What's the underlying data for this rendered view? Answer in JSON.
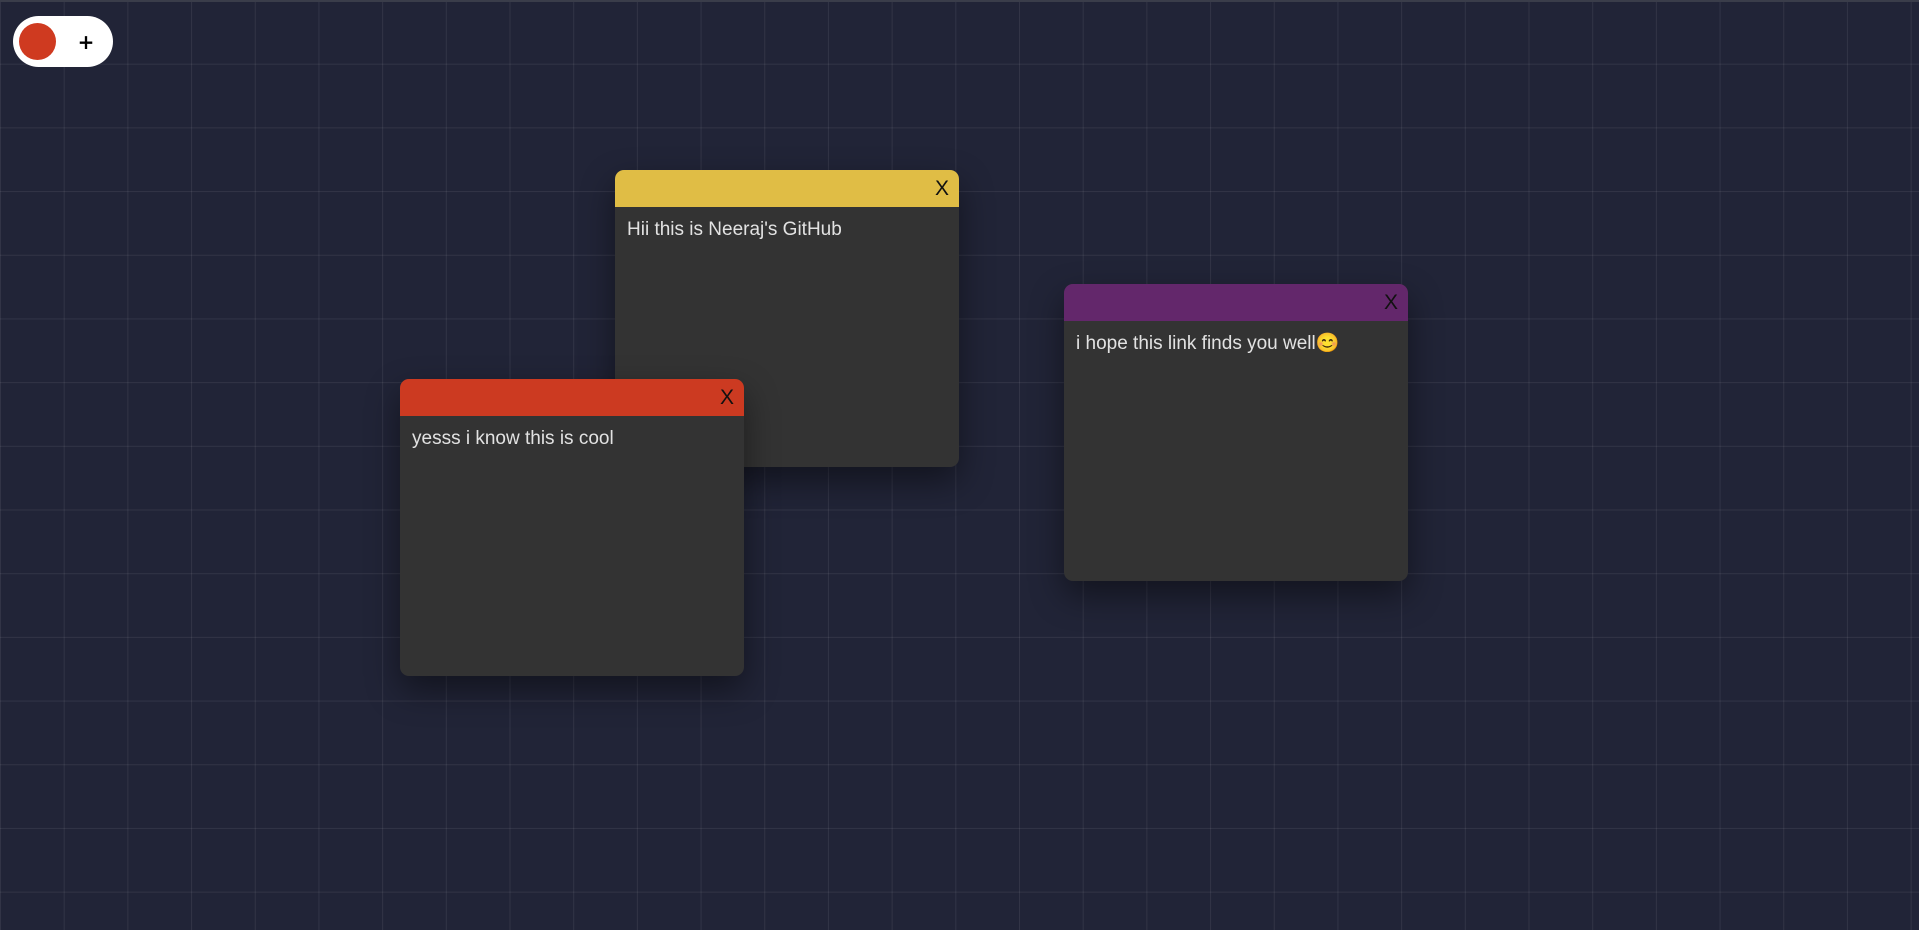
{
  "controls": {
    "selected_color": "#cf3a20",
    "add_label": "+"
  },
  "cards": [
    {
      "id": "card-yellow",
      "header_color": "#e0bd45",
      "close_label": "X",
      "text": "Hii this is Neeraj's GitHub"
    },
    {
      "id": "card-red",
      "header_color": "#cc3a21",
      "close_label": "X",
      "text": "yesss i know this is cool"
    },
    {
      "id": "card-purple",
      "header_color": "#63276b",
      "close_label": "X",
      "text": "i hope this link finds you well😊"
    }
  ]
}
